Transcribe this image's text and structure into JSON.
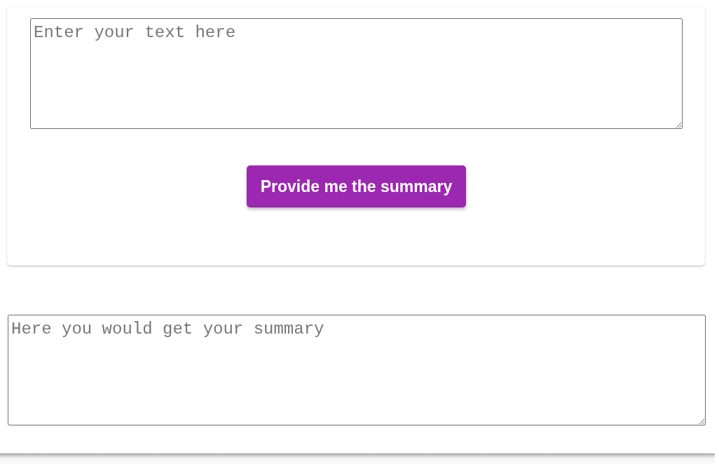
{
  "input": {
    "placeholder": "Enter your text here"
  },
  "submit_button": {
    "label": "Provide me the summary"
  },
  "output": {
    "placeholder": "Here you would get your summary"
  }
}
